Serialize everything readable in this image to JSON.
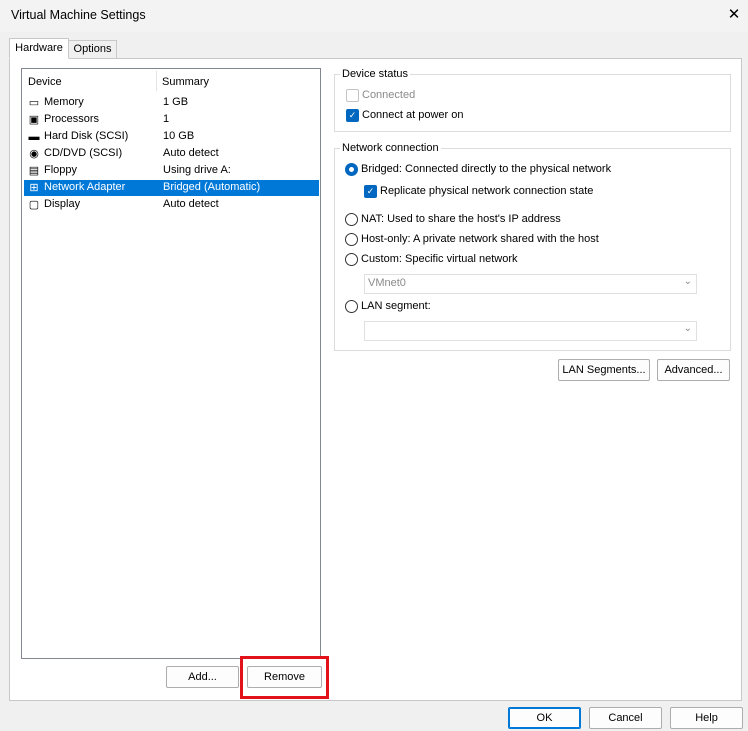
{
  "window": {
    "title": "Virtual Machine Settings"
  },
  "tabs": [
    {
      "label": "Hardware"
    },
    {
      "label": "Options"
    }
  ],
  "device_list": {
    "columns": [
      "Device",
      "Summary"
    ],
    "rows": [
      {
        "name": "Memory",
        "summary": "1 GB",
        "icon": "memory-icon"
      },
      {
        "name": "Processors",
        "summary": "1",
        "icon": "processor-icon"
      },
      {
        "name": "Hard Disk (SCSI)",
        "summary": "10 GB",
        "icon": "hard-disk-icon"
      },
      {
        "name": "CD/DVD (SCSI)",
        "summary": "Auto detect",
        "icon": "cd-dvd-icon"
      },
      {
        "name": "Floppy",
        "summary": "Using drive A:",
        "icon": "floppy-icon"
      },
      {
        "name": "Network Adapter",
        "summary": "Bridged (Automatic)",
        "icon": "network-adapter-icon",
        "selected": true
      },
      {
        "name": "Display",
        "summary": "Auto detect",
        "icon": "display-icon"
      }
    ]
  },
  "device_status": {
    "label": "Device status",
    "connected": "Connected",
    "connect_at_power_on": "Connect at power on"
  },
  "network_connection": {
    "label": "Network connection",
    "bridged": "Bridged: Connected directly to the physical network",
    "replicate": "Replicate physical network connection state",
    "nat": "NAT: Used to share the host's IP address",
    "host_only": "Host-only: A private network shared with the host",
    "custom": "Custom: Specific virtual network",
    "custom_value": "VMnet0",
    "lan_segment": "LAN segment:",
    "lan_segment_value": ""
  },
  "buttons": {
    "lan_segments": "LAN Segments...",
    "advanced": "Advanced...",
    "add": "Add...",
    "remove": "Remove",
    "ok": "OK",
    "cancel": "Cancel",
    "help": "Help"
  },
  "icons": {
    "close": "✕",
    "check": "✓",
    "chevron": "⌄"
  },
  "colors": {
    "accent": "#0078d7",
    "highlight_box": "#e3121a"
  }
}
